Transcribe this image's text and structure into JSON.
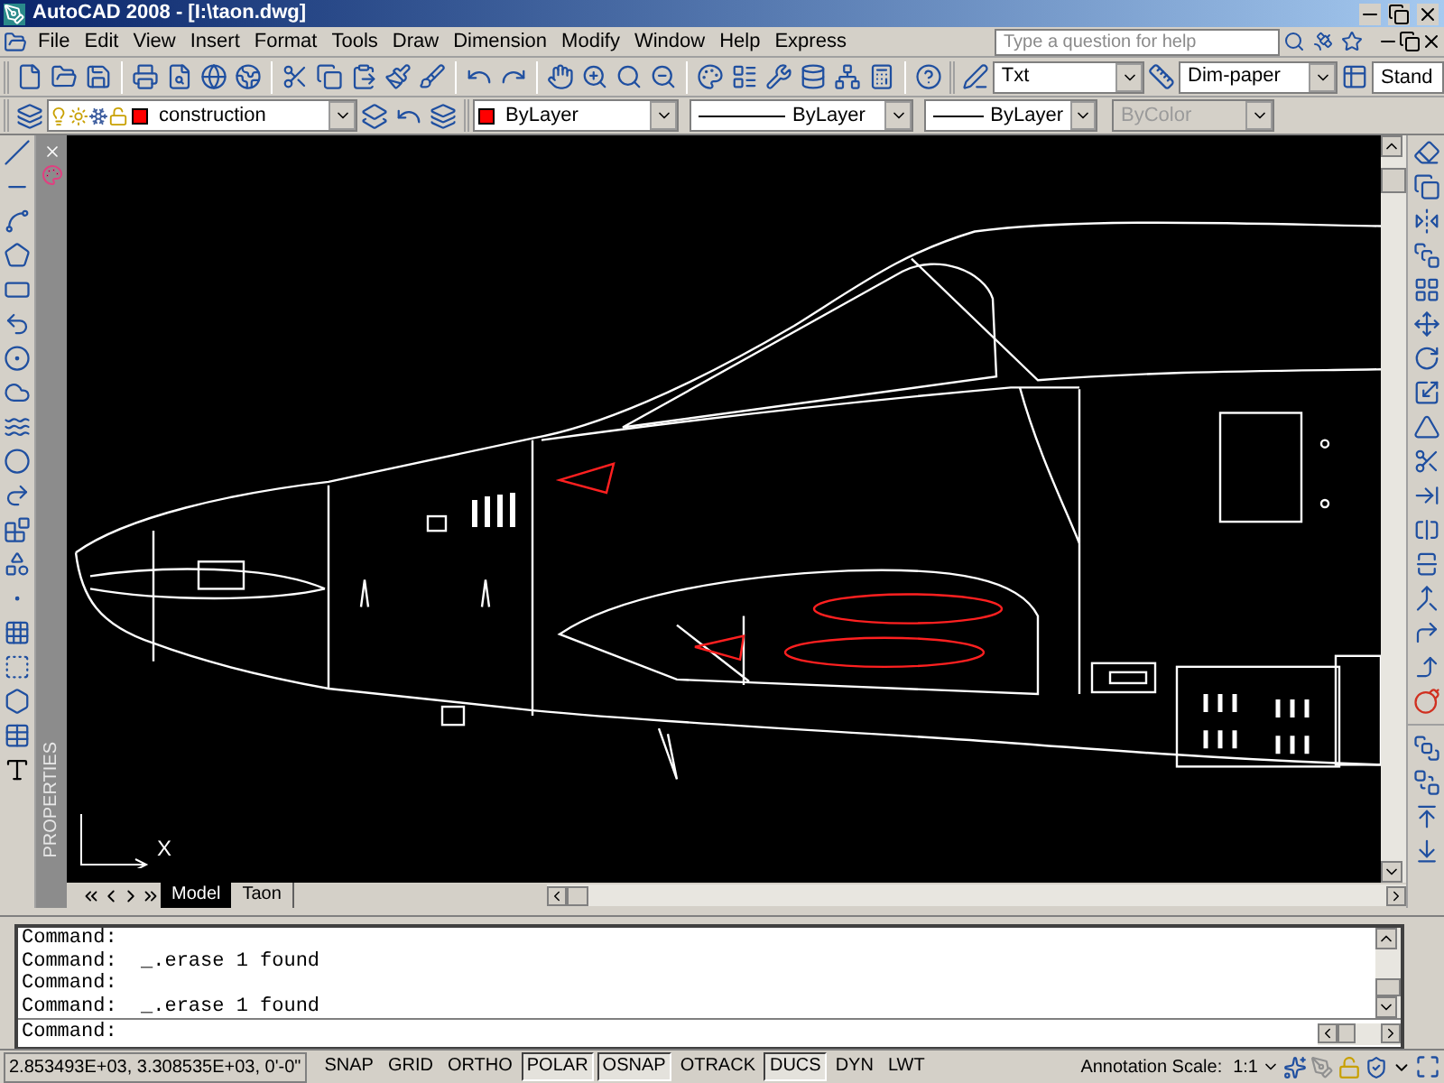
{
  "window": {
    "title": "AutoCAD 2008 - [I:\\taon.dwg]"
  },
  "menu": [
    "File",
    "Edit",
    "View",
    "Insert",
    "Format",
    "Tools",
    "Draw",
    "Dimension",
    "Modify",
    "Window",
    "Help",
    "Express"
  ],
  "help_search": {
    "placeholder": "Type a question for help"
  },
  "styles_toolbar": {
    "text_style": "Txt",
    "dim_style": "Dim-paper",
    "table_style": "Stand"
  },
  "layers_toolbar": {
    "layer": "construction",
    "color_value": "ByLayer",
    "linetype": "ByLayer",
    "lineweight": "ByLayer",
    "plot_style": {
      "value": "ByColor",
      "disabled": true
    }
  },
  "properties_palette": {
    "title": "PROPERTIES"
  },
  "ucs": {
    "x_label": "X"
  },
  "layout_tabs": [
    {
      "label": "Model",
      "selected": true
    },
    {
      "label": "Taon",
      "selected": false
    }
  ],
  "command_history": [
    "Command:",
    "Command:  _.erase 1 found",
    "Command:",
    "Command:  _.erase 1 found"
  ],
  "command_prompt": "Command:",
  "status_bar": {
    "coordinates": "2.853493E+03, 3.308535E+03, 0'-0\"",
    "toggles": [
      {
        "label": "SNAP",
        "on": false
      },
      {
        "label": "GRID",
        "on": false
      },
      {
        "label": "ORTHO",
        "on": false
      },
      {
        "label": "POLAR",
        "on": true
      },
      {
        "label": "OSNAP",
        "on": true
      },
      {
        "label": "OTRACK",
        "on": false
      },
      {
        "label": "DUCS",
        "on": true
      },
      {
        "label": "DYN",
        "on": false
      },
      {
        "label": "LWT",
        "on": false
      }
    ],
    "annotation_scale_label": "Annotation Scale:",
    "annotation_scale": "1:1"
  }
}
